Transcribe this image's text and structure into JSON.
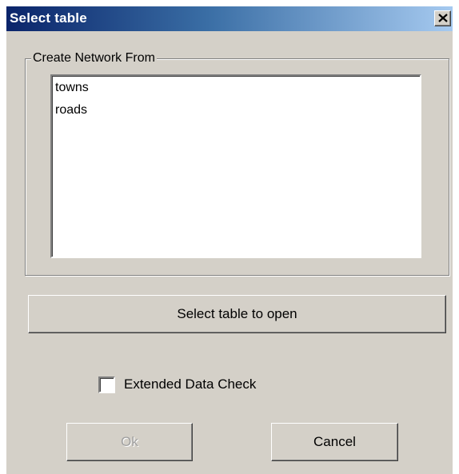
{
  "window": {
    "title": "Select table",
    "close_icon": "close-icon"
  },
  "group": {
    "label": "Create Network From",
    "items": [
      {
        "label": "towns"
      },
      {
        "label": "roads"
      }
    ]
  },
  "buttons": {
    "select_table": "Select table to open",
    "ok": "Ok",
    "ok_disabled": true,
    "cancel": "Cancel"
  },
  "options": {
    "extended_check_label": "Extended Data Check",
    "extended_check_checked": false
  },
  "colors": {
    "title_start": "#0a246a",
    "title_end": "#a6caf0",
    "dialog_bg": "#d4d0c8"
  }
}
